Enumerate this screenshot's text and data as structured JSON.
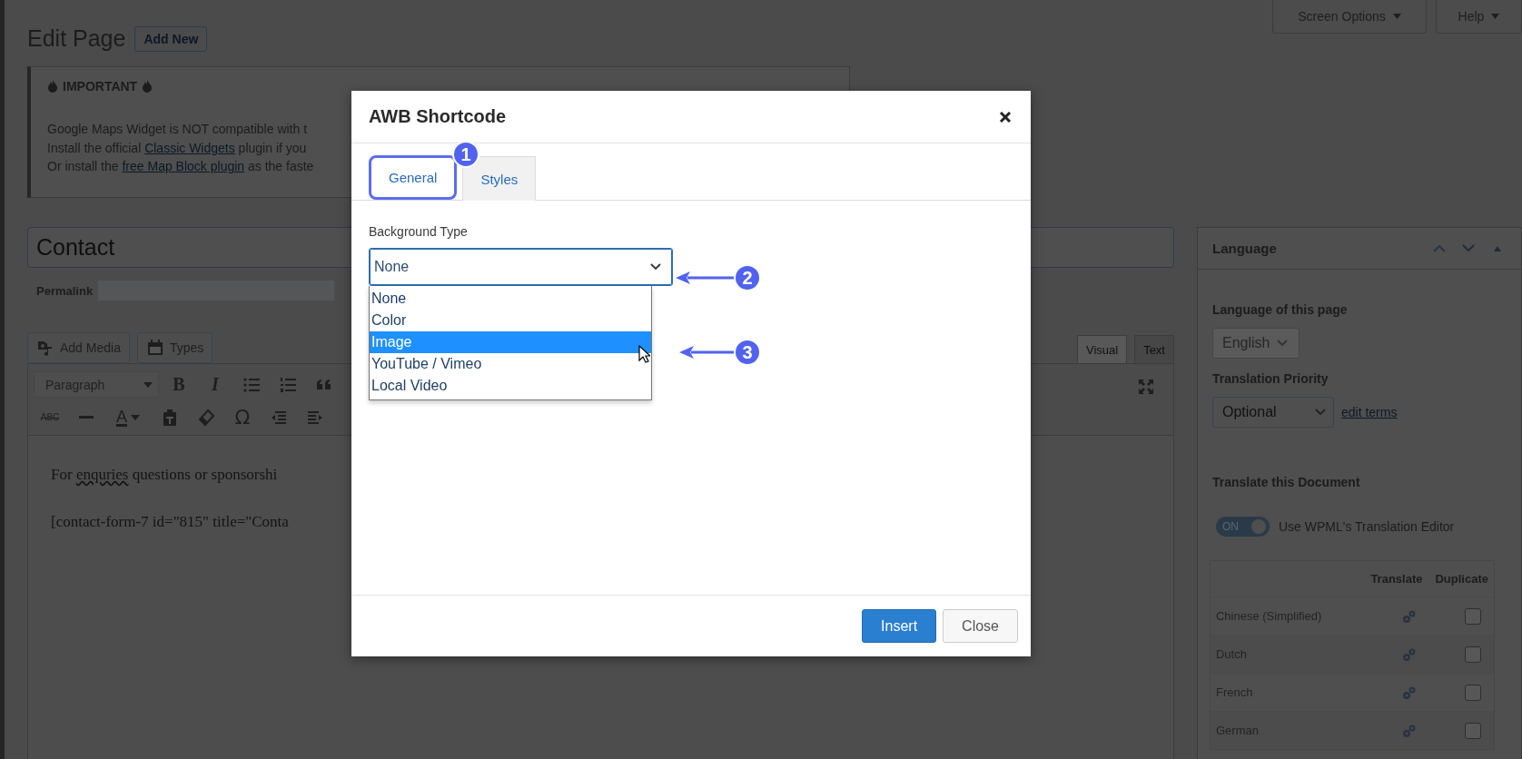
{
  "screen_meta": {
    "screen_options": "Screen Options",
    "help": "Help"
  },
  "header": {
    "title": "Edit Page",
    "add_new": "Add New"
  },
  "notice": {
    "heading": "IMPORTANT",
    "lines": [
      {
        "before": "Google Maps Widget is NOT compatible with t"
      },
      {
        "before": "Install the official ",
        "link": "Classic Widgets",
        "after": " plugin if you"
      },
      {
        "before": "Or install the ",
        "link": "free Map Block plugin",
        "after": " as the faste"
      }
    ]
  },
  "post_title": {
    "value": "Contact"
  },
  "permalink": {
    "label": "Permalink"
  },
  "media_buttons": [
    "Add Media",
    "Types"
  ],
  "editor": {
    "tabs": [
      {
        "label": "Visual",
        "selected": true
      },
      {
        "label": "Text",
        "selected": false
      }
    ],
    "format": "Paragraph",
    "glyphs": {
      "bold": "B",
      "italic": "I",
      "strike": "ABC",
      "text_color": "A",
      "special_char": "Ω"
    },
    "paragraphs": [
      {
        "before": "For ",
        "misspelled": "enquries",
        "after": " questions or sponsorshi"
      },
      {
        "before": "[contact-form-7 id=\"815\" title=\"Conta"
      }
    ]
  },
  "sidebar": {
    "title": "Language",
    "language_label": "Language of this page",
    "language": {
      "value": "English",
      "disabled": true
    },
    "priority_label": "Translation Priority",
    "priority": {
      "value": "Optional"
    },
    "edit_terms": "edit terms",
    "translate_heading": "Translate this Document",
    "toggle": {
      "label": "ON",
      "on": true
    },
    "toggle_text": "Use WPML's Translation Editor",
    "table": {
      "columns": [
        "Translate",
        "Duplicate"
      ],
      "rows": [
        {
          "language": "Chinese (Simplified)",
          "duplicate": false
        },
        {
          "language": "Dutch",
          "duplicate": false
        },
        {
          "language": "French",
          "duplicate": false
        },
        {
          "language": "German",
          "duplicate": false
        }
      ]
    }
  },
  "modal": {
    "title": "AWB Shortcode",
    "tabs": [
      {
        "label": "General",
        "selected": true
      },
      {
        "label": "Styles",
        "selected": false
      }
    ],
    "field_label": "Background Type",
    "select": {
      "value": "None",
      "expanded": true,
      "options": [
        {
          "label": "None",
          "highlighted": false
        },
        {
          "label": "Color",
          "highlighted": false
        },
        {
          "label": "Image",
          "highlighted": true
        },
        {
          "label": "YouTube / Vimeo",
          "highlighted": false
        },
        {
          "label": "Local Video",
          "highlighted": false
        }
      ]
    },
    "buttons": [
      {
        "label": "Insert",
        "kind": "primary"
      },
      {
        "label": "Close",
        "kind": "secondary"
      }
    ]
  },
  "annotations": [
    {
      "number": "1"
    },
    {
      "number": "2"
    },
    {
      "number": "3"
    }
  ]
}
